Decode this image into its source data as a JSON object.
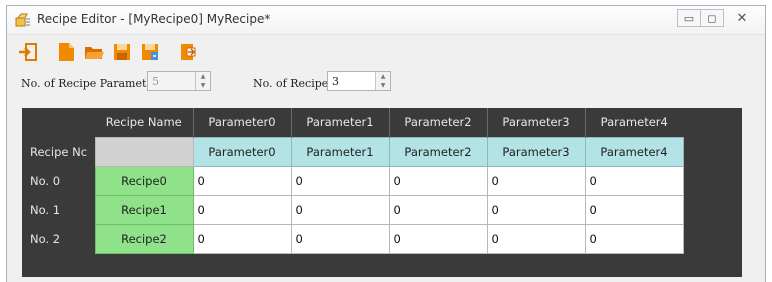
{
  "window": {
    "title": "Recipe Editor - [MyRecipe0] MyRecipe*",
    "controls": {
      "minimize": "▭",
      "maximize": "◻",
      "close": "✕"
    }
  },
  "toolbar": {
    "icons": [
      "import-icon",
      "new-file-icon",
      "open-folder-icon",
      "save-icon",
      "save-as-icon",
      "export-icon"
    ]
  },
  "params": {
    "num_params_label": "No. of Recipe Parameters",
    "num_params_value": "5",
    "num_recipe_label": "No. of Recipe",
    "num_recipe_value": "3"
  },
  "grid": {
    "corner_label": "Recipe Nc",
    "name_header": "Recipe Name",
    "columns": [
      "Parameter0",
      "Parameter1",
      "Parameter2",
      "Parameter3",
      "Parameter4"
    ],
    "param_names": [
      "Parameter0",
      "Parameter1",
      "Parameter2",
      "Parameter3",
      "Parameter4"
    ],
    "rows": [
      {
        "label": "No. 0",
        "name": "Recipe0",
        "values": [
          "0",
          "0",
          "0",
          "0",
          "0"
        ]
      },
      {
        "label": "No. 1",
        "name": "Recipe1",
        "values": [
          "0",
          "0",
          "0",
          "0",
          "0"
        ]
      },
      {
        "label": "No. 2",
        "name": "Recipe2",
        "values": [
          "0",
          "0",
          "0",
          "0",
          "0"
        ]
      }
    ]
  }
}
